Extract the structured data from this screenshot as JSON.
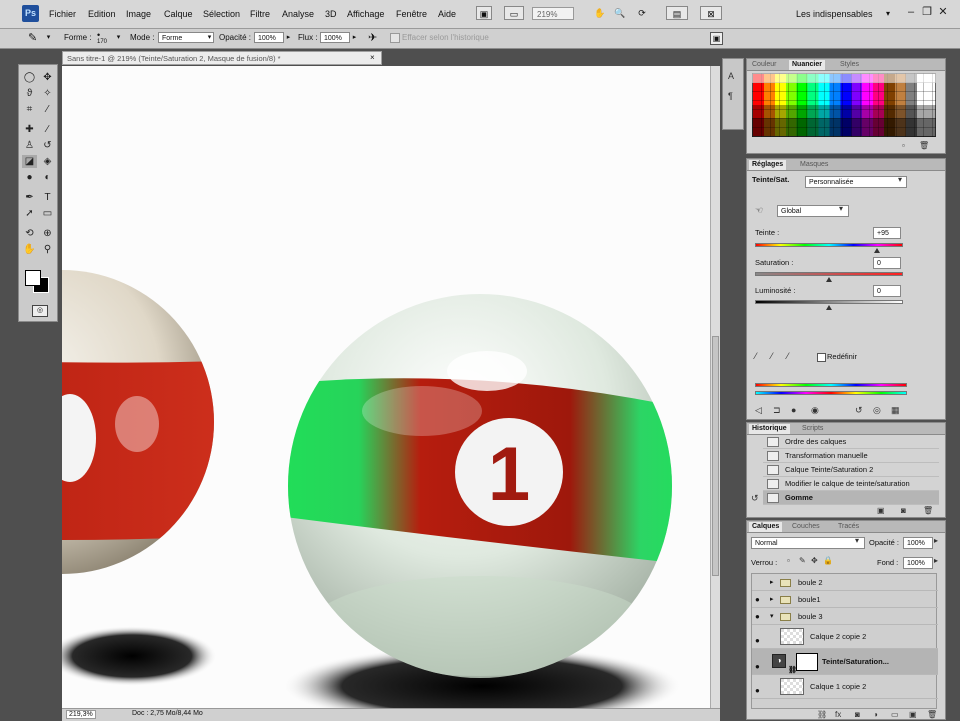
{
  "app": {
    "logo": "Ps"
  },
  "menu": {
    "items": [
      "Fichier",
      "Edition",
      "Image",
      "Calque",
      "Sélection",
      "Filtre",
      "Analyse",
      "3D",
      "Affichage",
      "Fenêtre",
      "Aide"
    ],
    "zoom": "219%",
    "workspace": "Les indispensables",
    "workspace_arrow": "▾"
  },
  "options": {
    "brush_size": "170",
    "mode_label": "Mode :",
    "mode_value": "Forme",
    "opacity_label": "Opacité :",
    "opacity_value": "100%",
    "flow_label": "Flux :",
    "flow_value": "100%",
    "forme_label": "Forme :",
    "history_label": "Effacer selon l'historique"
  },
  "document": {
    "tab_title": "Sans titre-1 @ 219% (Teinte/Saturation 2, Masque de fusion/8) *",
    "close": "×",
    "status_zoom": "219,3%",
    "status_doc": "Doc : 2,75 Mo/8,44 Mo"
  },
  "canvas": {
    "ball_number": "1",
    "colors": {
      "band_red": "#b61d0e",
      "band_green": "#1fe158",
      "ball_white": "#e9efe9",
      "number": "#a11a10"
    }
  },
  "swatches_panel": {
    "tabs": [
      "Couleur",
      "Nuancier",
      "Styles"
    ],
    "active": 1
  },
  "adjust_panel": {
    "tabs": [
      "Réglages",
      "Masques"
    ],
    "title": "Teinte/Sat.",
    "preset": "Personnalisée",
    "channel": "Global",
    "hue_label": "Teinte :",
    "hue_value": "+95",
    "sat_label": "Saturation :",
    "sat_value": "0",
    "lum_label": "Luminosité :",
    "lum_value": "0",
    "colorize_label": "Redéfinir"
  },
  "history_panel": {
    "tabs": [
      "Historique",
      "Scripts"
    ],
    "items": [
      "Ordre des calques",
      "Transformation manuelle",
      "Calque Teinte/Saturation 2",
      "Modifier le calque de teinte/saturation",
      "Gomme"
    ],
    "selected": 4
  },
  "layers_panel": {
    "tabs": [
      "Calques",
      "Couches",
      "Tracés"
    ],
    "blend_mode": "Normal",
    "opacity_label": "Opacité :",
    "opacity_value": "100%",
    "lock_label": "Verrou :",
    "fill_label": "Fond :",
    "fill_value": "100%",
    "layers": [
      {
        "name": "boule 2",
        "type": "group",
        "visible": false
      },
      {
        "name": "boule1",
        "type": "group",
        "visible": true
      },
      {
        "name": "boule 3",
        "type": "group",
        "visible": true
      },
      {
        "name": "Calque 2 copie 2",
        "type": "layer",
        "visible": true
      },
      {
        "name": "Teinte/Saturation...",
        "type": "adjustment",
        "visible": true
      },
      {
        "name": "Calque 1 copie 2",
        "type": "layer",
        "visible": true
      }
    ],
    "selected": 4
  }
}
